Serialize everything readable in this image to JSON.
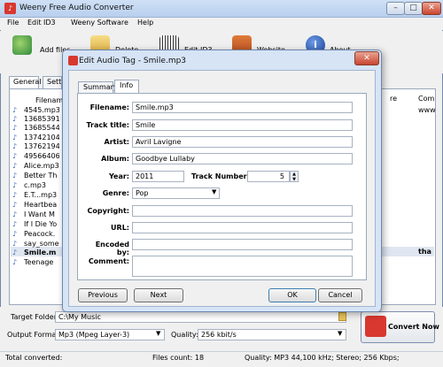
{
  "window": {
    "title": "Weeny Free Audio Converter"
  },
  "menu": [
    "File",
    "Edit ID3",
    "Weeny Software",
    "Help"
  ],
  "toolbar": {
    "add_files": "Add files",
    "delete": "Delete",
    "edit_id3": "Edit ID3",
    "website": "Website",
    "about": "About"
  },
  "main_tabs": [
    "General",
    "Setti"
  ],
  "list": {
    "col_filename": "Filename",
    "col_re": "re",
    "col_com": "Com",
    "col_com_val": "www",
    "sel_right": "tha",
    "files": [
      "4545.mp3",
      "13685391",
      "13685544",
      "13742104",
      "13762194",
      "49566406",
      "Alice.mp3",
      "Better Th",
      "c.mp3",
      "E.T...mp3",
      "Heartbea",
      "I Want M",
      "If I Die Yo",
      "Peacock.",
      "say_some",
      "Smile.m",
      "Teenage"
    ]
  },
  "bottom": {
    "target_label": "Target Folder:",
    "target_value": "C:\\My Music",
    "format_label": "Output Format:",
    "format_value": "Mp3 (Mpeg Layer-3)",
    "quality_label": "Quality:",
    "quality_value": "256 kbit/s",
    "convert_label": "Convert Now"
  },
  "status": {
    "total": "Total converted:",
    "files_count": "Files count: 18",
    "quality": "Quality: MP3 44,100 kHz; Stereo;  256 Kbps;"
  },
  "dialog": {
    "title": "Edit Audio Tag - Smile.mp3",
    "tabs": [
      "Summary",
      "Info"
    ],
    "filename_label": "Filename:",
    "filename_value": "Smile.mp3",
    "track_title_label": "Track title:",
    "track_title_value": "Smile",
    "artist_label": "Artist:",
    "artist_value": "Avril Lavigne",
    "album_label": "Album:",
    "album_value": "Goodbye Lullaby",
    "year_label": "Year:",
    "year_value": "2011",
    "track_number_label": "Track Number:",
    "track_number_value": "5",
    "genre_label": "Genre:",
    "genre_value": "Pop",
    "copyright_label": "Copyright:",
    "url_label": "URL:",
    "encoded_label": "Encoded by:",
    "comment_label": "Comment:",
    "previous": "Previous",
    "next": "Next",
    "ok": "OK",
    "cancel": "Cancel"
  },
  "colors": {
    "accent": "#d8382f",
    "frame": "#d6e4f6"
  }
}
